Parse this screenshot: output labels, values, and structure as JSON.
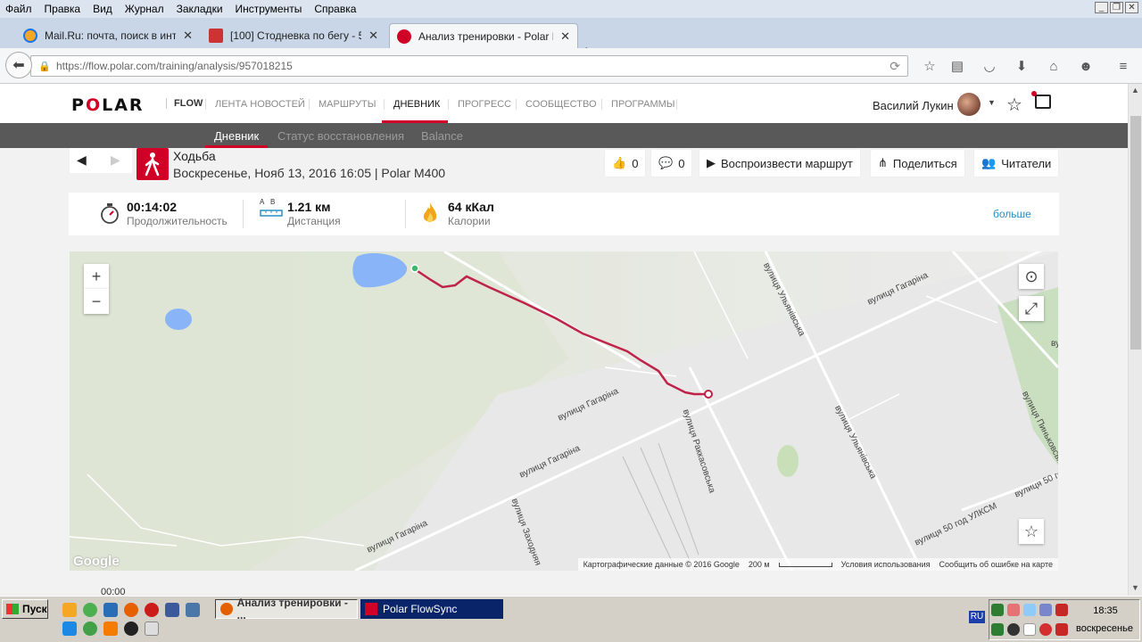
{
  "browser": {
    "menu": [
      "Файл",
      "Правка",
      "Вид",
      "Журнал",
      "Закладки",
      "Инструменты",
      "Справка"
    ],
    "tabs": [
      {
        "title": "Mail.Ru: почта, поиск в инт...",
        "active": false
      },
      {
        "title": "[100] Стодневка по бегу - 5...",
        "active": false
      },
      {
        "title": "Анализ тренировки - Polar F...",
        "active": true
      }
    ],
    "url": "https://flow.polar.com/training/analysis/957018215"
  },
  "site": {
    "logo": "POLAR",
    "flow": "FLOW",
    "nav": [
      "ЛЕНТА НОВОСТЕЙ",
      "МАРШРУТЫ",
      "ДНЕВНИК",
      "ПРОГРЕСС",
      "СООБЩЕСТВО",
      "ПРОГРАММЫ"
    ],
    "nav_active": "ДНЕВНИК",
    "user_name": "Василий Лукин",
    "subnav": [
      "Дневник",
      "Статус восстановления",
      "Balance"
    ]
  },
  "training": {
    "sport": "Ходьба",
    "subtitle": "Воскресенье, Нояб 13, 2016 16:05 | Polar M400",
    "likes": "0",
    "comments": "0",
    "play_route": "Воспроизвести маршрут",
    "share": "Поделиться",
    "readers": "Читатели"
  },
  "stats": {
    "duration_value": "00:14:02",
    "duration_label": "Продолжительность",
    "distance_value": "1.21 км",
    "distance_label": "Дистанция",
    "distance_a": "A",
    "distance_b": "B",
    "calories_value": "64 кКал",
    "calories_label": "Калории",
    "more": "больше"
  },
  "map": {
    "zoom_in": "+",
    "zoom_out": "−",
    "streets": [
      "вулиця Гагаріна",
      "вулиця Гагаріна",
      "вулиця Гагаріна",
      "вулиця Гагаріна",
      "вулиця Ульянівська",
      "вулиця Ульянівська",
      "вулиця Раккасовська",
      "вулиця Заходняя",
      "вулиця 50 год УЛКСМ",
      "вулиця 50 год",
      "вулиця Пиньковська",
      "ву"
    ],
    "google": "Google",
    "attribution": "Картографические данные © 2016 Google",
    "scale": "200 м",
    "terms": "Условия использования",
    "report": "Сообщить об ошибке на карте"
  },
  "time_stub": "00:00",
  "taskbar": {
    "start": "Пуск",
    "tasks": [
      "Анализ тренировки - ...",
      "Polar FlowSync"
    ],
    "lang": "RU",
    "time": "18:35",
    "day": "воскресенье"
  }
}
